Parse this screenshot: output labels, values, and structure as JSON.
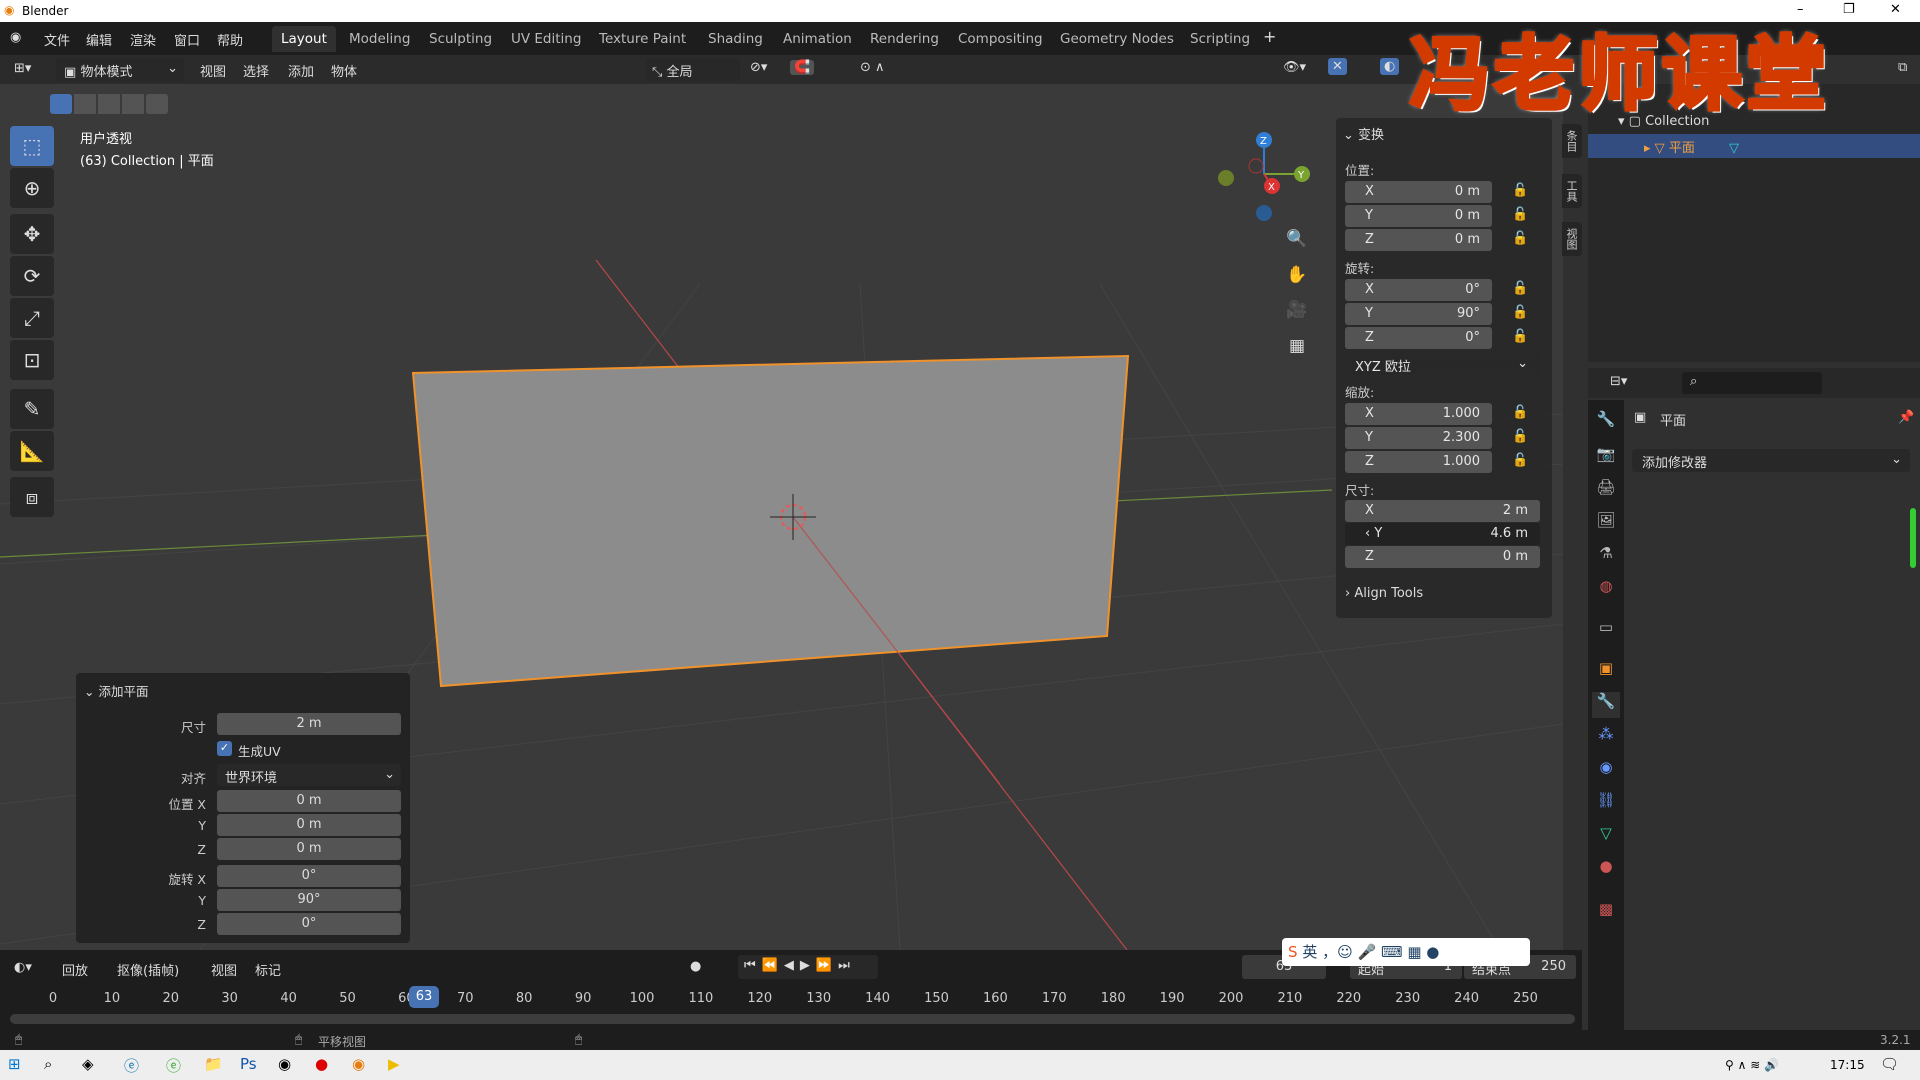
{
  "app": {
    "title": "Blender",
    "version": "3.2.1"
  },
  "menu": [
    "文件",
    "编辑",
    "渲染",
    "窗口",
    "帮助"
  ],
  "workspaces": [
    "Layout",
    "Modeling",
    "Sculpting",
    "UV Editing",
    "Texture Paint",
    "Shading",
    "Animation",
    "Rendering",
    "Compositing",
    "Geometry Nodes",
    "Scripting"
  ],
  "active_workspace": "Layout",
  "viewport_header": {
    "mode": "物体模式",
    "menus": [
      "视图",
      "选择",
      "添加",
      "物体"
    ],
    "transform_orientation": "全局"
  },
  "viewport": {
    "view_name": "用户透视",
    "object_info": "(63) Collection | 平面",
    "gizmo_axes": [
      "X",
      "Y",
      "Z"
    ],
    "selection_color": "#f0922b"
  },
  "tools": [
    "select-box",
    "cursor",
    "move",
    "rotate",
    "scale",
    "transform",
    "annotate",
    "measure",
    "add-cube"
  ],
  "npanel": {
    "tabs": [
      "条目",
      "工具",
      "视图"
    ],
    "section": "变换",
    "location_label": "位置:",
    "location": {
      "X": "0 m",
      "Y": "0 m",
      "Z": "0 m"
    },
    "rotation_label": "旋转:",
    "rotation": {
      "X": "0°",
      "Y": "90°",
      "Z": "0°"
    },
    "rotation_mode": "XYZ 欧拉",
    "scale_label": "缩放:",
    "scale": {
      "X": "1.000",
      "Y": "2.300",
      "Z": "1.000"
    },
    "dimensions_label": "尺寸:",
    "dimensions": {
      "X": "2 m",
      "Y": "4.6 m",
      "Z": "0 m"
    },
    "align_tools": "Align Tools"
  },
  "operator_panel": {
    "title": "添加平面",
    "size_label": "尺寸",
    "size": "2 m",
    "generate_uv": "生成UV",
    "generate_uv_checked": true,
    "align_label": "对齐",
    "align": "世界环境",
    "location_label": "位置 X",
    "loc": {
      "X": "0 m",
      "Y": "0 m",
      "Z": "0 m"
    },
    "rotation_label": "旋转 X",
    "rot": {
      "X": "0°",
      "Y": "90°",
      "Z": "0°"
    },
    "y_label": "Y",
    "z_label": "Z"
  },
  "outliner": {
    "collection": "Collection",
    "object": "平面"
  },
  "properties": {
    "object_name": "平面",
    "add_modifier": "添加修改器"
  },
  "timeline": {
    "menus": [
      "回放",
      "抠像(插帧)",
      "视图",
      "标记"
    ],
    "current_frame": "63",
    "start_label": "起始",
    "start": "1",
    "end_label": "结束点",
    "end": "250",
    "ticks": [
      "0",
      "10",
      "20",
      "30",
      "40",
      "50",
      "60",
      "70",
      "80",
      "90",
      "100",
      "110",
      "120",
      "130",
      "140",
      "150",
      "160",
      "170",
      "180",
      "190",
      "200",
      "210",
      "220",
      "230",
      "240",
      "250"
    ]
  },
  "status": {
    "hint": "平移视图"
  },
  "taskbar": {
    "time": "17:15"
  },
  "ime": {
    "lang": "英"
  },
  "watermark": "冯老师课堂"
}
